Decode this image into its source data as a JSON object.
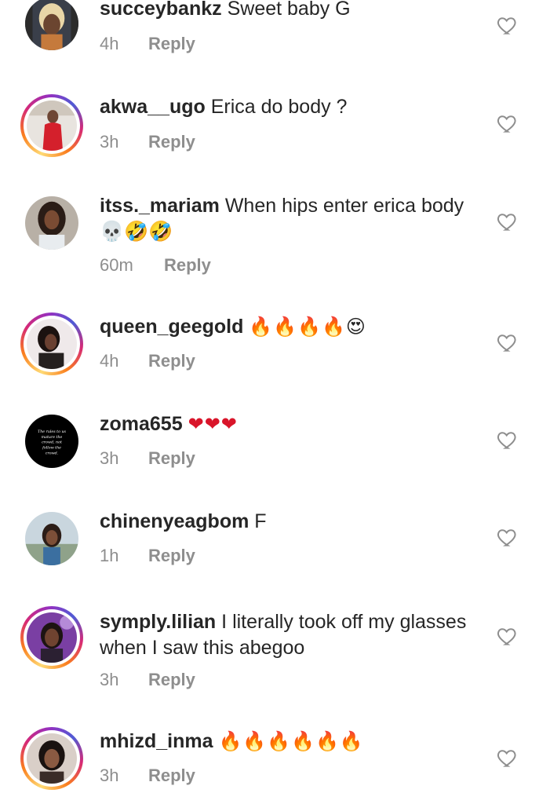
{
  "comments": [
    {
      "username": "succeybankz",
      "text": "Sweet baby G",
      "time": "4h",
      "reply": "Reply",
      "avatar_icon": "profile-photo-blonde",
      "story_ring": false
    },
    {
      "username": "akwa__ugo",
      "text": "Erica do body ?",
      "time": "3h",
      "reply": "Reply",
      "avatar_icon": "profile-photo-red-dress",
      "story_ring": true
    },
    {
      "username": "itss._mariam",
      "text": "When hips enter erica body💀🤣🤣",
      "time": "60m",
      "reply": "Reply",
      "avatar_icon": "profile-photo-braids",
      "story_ring": false
    },
    {
      "username": "queen_geegold",
      "text": "🔥🔥🔥🔥😍",
      "time": "4h",
      "reply": "Reply",
      "avatar_icon": "profile-photo-selfie",
      "story_ring": true
    },
    {
      "username": "zoma655",
      "text": "❤❤❤",
      "time": "3h",
      "reply": "Reply",
      "avatar_icon": "quote-avatar-black",
      "story_ring": false
    },
    {
      "username": "chinenyeagbom",
      "text": "F",
      "time": "1h",
      "reply": "Reply",
      "avatar_icon": "profile-photo-outdoor",
      "story_ring": false
    },
    {
      "username": "symply.lilian",
      "text": "I literally took off my glasses when I saw this abegoo",
      "time": "3h",
      "reply": "Reply",
      "avatar_icon": "profile-photo-purple",
      "story_ring": true
    },
    {
      "username": "mhizd_inma",
      "text": "🔥🔥🔥🔥🔥🔥",
      "time": "3h",
      "reply": "Reply",
      "avatar_icon": "profile-photo-closeup",
      "story_ring": true
    }
  ],
  "colors": {
    "text": "#262626",
    "secondary": "#8e8e8e",
    "heart_outline": "#8e8e8e"
  },
  "quote_avatar_text": "The rules to us mature the...crowd, not follow the crowd."
}
